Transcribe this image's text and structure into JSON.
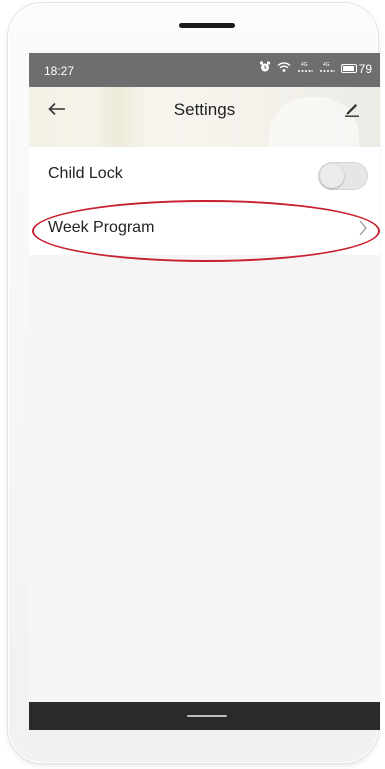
{
  "status_bar": {
    "time": "18:27",
    "battery": "79",
    "signal1_label": "4G",
    "signal2_label": "4G"
  },
  "header": {
    "title": "Settings",
    "back_icon": "back-arrow-icon",
    "edit_icon": "edit-pen-icon"
  },
  "settings": {
    "items": [
      {
        "label": "Child Lock",
        "control": "toggle",
        "enabled": false
      },
      {
        "label": "Week Program",
        "control": "chevron"
      }
    ]
  },
  "annotation": {
    "color": "#c8202f",
    "target": "Week Program"
  }
}
